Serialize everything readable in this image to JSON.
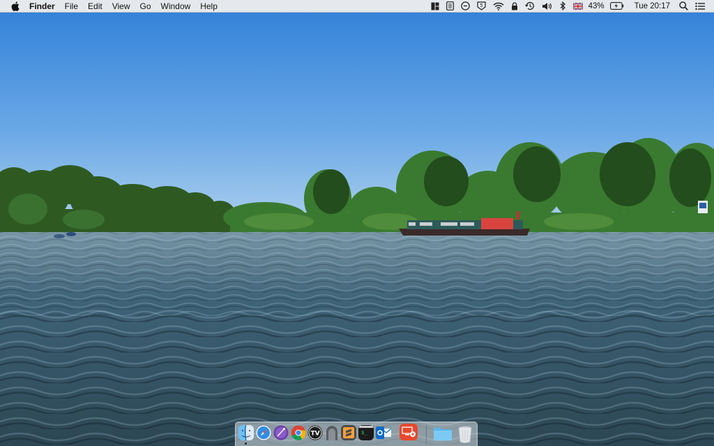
{
  "menubar": {
    "app_name": "Finder",
    "menus": [
      "File",
      "Edit",
      "View",
      "Go",
      "Window",
      "Help"
    ],
    "status": {
      "battery_percent": "43%",
      "clock": "Tue 20:17",
      "input_source": "british-flag",
      "icons": [
        "magnet-icon",
        "notes-icon",
        "clipboard-icon",
        "five-icon",
        "wifi-icon",
        "lock-icon",
        "time-machine-icon",
        "volume-icon",
        "bluetooth-icon",
        "flag-icon",
        "battery-icon",
        "spotlight-icon",
        "notification-center-icon"
      ]
    }
  },
  "desktop": {
    "wallpaper": "river-with-narrowboat"
  },
  "dock": {
    "apps": [
      "Finder",
      "Safari",
      "Instruments",
      "Google Chrome",
      "TextVoice",
      "Sketch Mirror",
      "Sublime Text",
      "Terminal",
      "Microsoft Outlook",
      "Remote Desktop"
    ],
    "items": [
      "Downloads",
      "Trash"
    ]
  },
  "colors": {
    "sky_top": "#2f7fd8",
    "sky_horizon": "#b3d4ef",
    "water": "#3d6175",
    "trees": "#2b5a1e"
  }
}
